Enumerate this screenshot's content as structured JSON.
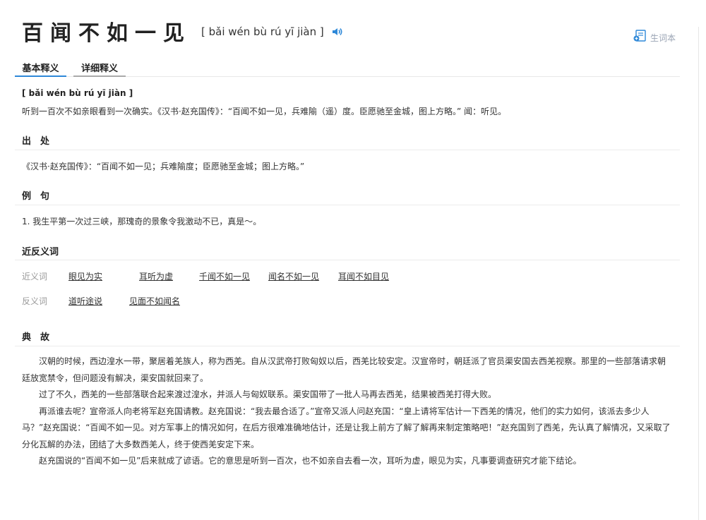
{
  "header": {
    "word": "百闻不如一见",
    "pinyin": "[ bǎi wén bù rú yī jiàn ]"
  },
  "vocab": {
    "label": "生词本"
  },
  "tabs": [
    {
      "label": "基本释义"
    },
    {
      "label": "详细释义"
    }
  ],
  "basic": {
    "pinyin": "[ bǎi wén bù rú yī jiàn ]",
    "definition": "听到一百次不如亲眼看到一次确实。《汉书·赵充国传》：“百闻不如一见，兵难隃（遥）度。臣愿驰至金城，图上方略。” 闻：听见。"
  },
  "source": {
    "title": "出　处",
    "text": "《汉书·赵充国传》：“百闻不如一见；兵难隃度；臣愿驰至金城；图上方略。”"
  },
  "examples": {
    "title": "例　句",
    "items": [
      "1. 我生平第一次过三峡，那瑰奇的景象令我激动不已，真是～。"
    ]
  },
  "synonyms": {
    "title": "近反义词",
    "syn_label": "近义词",
    "syn_items": [
      "眼见为实",
      "耳听为虚",
      "千闻不如一见",
      "闻名不如一见",
      "耳闻不如目见"
    ],
    "ant_label": "反义词",
    "ant_items": [
      "道听途说",
      "见面不如闻名"
    ]
  },
  "story": {
    "title": "典　故",
    "paragraphs": [
      "汉朝的时候，西边湟水一带，聚居着羌族人，称为西羌。自从汉武帝打败匈奴以后，西羌比较安定。汉宣帝时，朝廷派了官员渠安国去西羌视察。那里的一些部落请求朝廷放宽禁令，但问题没有解决，渠安国就回来了。",
      "过了不久，西羌的一些部落联合起来渡过湟水，并派人与匈奴联系。渠安国带了一批人马再去西羌，结果被西羌打得大败。",
      "再派谁去呢？宣帝派人向老将军赵充国请教。赵充国说：“我去最合适了。”宣帝又派人问赵充国：“皇上请将军估计一下西羌的情况，他们的实力如何，该派去多少人马？”赵充国说：“百闻不如一见。对方军事上的情况如何，在后方很难准确地估计，还是让我上前方了解了解再来制定策略吧！”赵充国到了西羌，先认真了解情况，又采取了分化瓦解的办法，团结了大多数西羌人，终于使西羌安定下来。",
      "赵充国说的“百闻不如一见”后来就成了谚语。它的意思是听到一百次，也不如亲自去看一次，耳听为虚，眼见为实，凡事要调查研究才能下结论。"
    ]
  },
  "colors": {
    "accent": "#2e88d8",
    "muted": "#999999"
  }
}
